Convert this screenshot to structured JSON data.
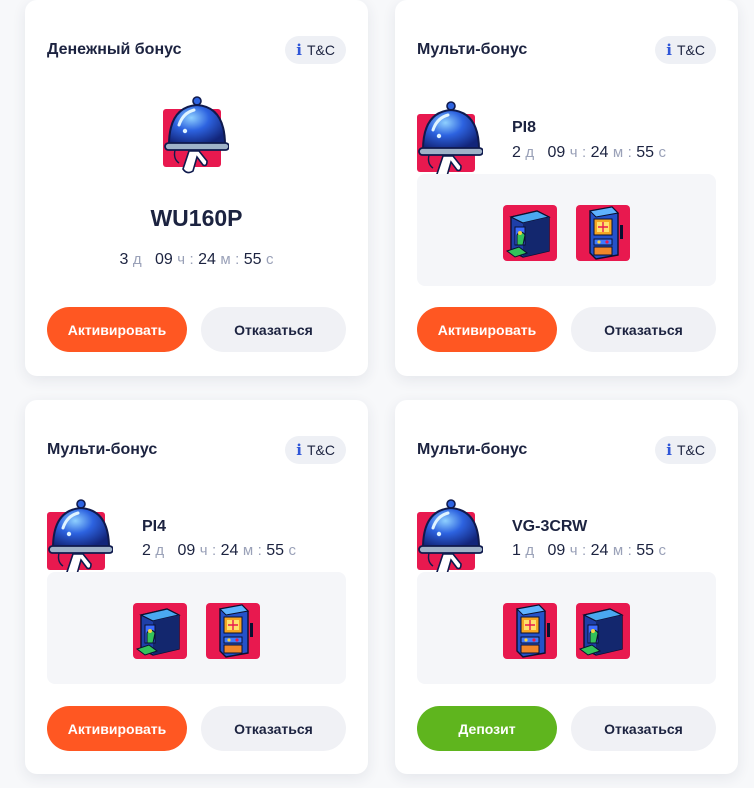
{
  "colors": {
    "activate": "#ff5722",
    "deposit": "#5fb51e",
    "decline_bg": "#f0f1f5",
    "tc_icon": "#2f56d8",
    "card_bg": "#ffffff"
  },
  "cards": [
    {
      "title": "Денежный бонус",
      "tc_icon": "i",
      "tc_label": "T&C",
      "icon": "cloche-icon",
      "code": "WU160P",
      "timer": {
        "d": "3",
        "d_unit": "д",
        "h": "09",
        "h_unit": "ч",
        "m": "24",
        "m_unit": "м",
        "s": "55",
        "s_unit": "с",
        "sep": ":"
      },
      "primary_label": "Активировать",
      "secondary_label": "Отказаться"
    },
    {
      "title": "Мульти-бонус",
      "tc_icon": "i",
      "tc_label": "T&C",
      "icon": "cloche-icon",
      "code": "PI8",
      "timer": {
        "d": "2",
        "d_unit": "д",
        "h": "09",
        "h_unit": "ч",
        "m": "24",
        "m_unit": "м",
        "s": "55",
        "s_unit": "с",
        "sep": ":"
      },
      "games": [
        "safe-game-icon",
        "arcade-game-icon"
      ],
      "primary_label": "Активировать",
      "secondary_label": "Отказаться"
    },
    {
      "title": "Мульти-бонус",
      "tc_icon": "i",
      "tc_label": "T&C",
      "icon": "cloche-icon",
      "code": "PI4",
      "timer": {
        "d": "2",
        "d_unit": "д",
        "h": "09",
        "h_unit": "ч",
        "m": "24",
        "m_unit": "м",
        "s": "55",
        "s_unit": "с",
        "sep": ":"
      },
      "games": [
        "safe-game-icon",
        "arcade-game-icon"
      ],
      "primary_label": "Активировать",
      "secondary_label": "Отказаться"
    },
    {
      "title": "Мульти-бонус",
      "tc_icon": "i",
      "tc_label": "T&C",
      "icon": "cloche-icon",
      "code": "VG-3CRW",
      "timer": {
        "d": "1",
        "d_unit": "д",
        "h": "09",
        "h_unit": "ч",
        "m": "24",
        "m_unit": "м",
        "s": "55",
        "s_unit": "с",
        "sep": ":"
      },
      "games": [
        "arcade-game-icon",
        "safe-game-icon"
      ],
      "primary_label": "Депозит",
      "secondary_label": "Отказаться"
    }
  ]
}
